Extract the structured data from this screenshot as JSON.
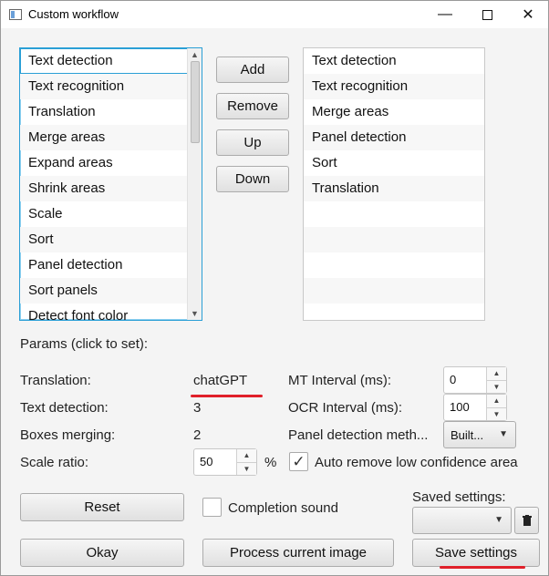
{
  "window": {
    "title": "Custom workflow"
  },
  "available_steps": [
    "Text detection",
    "Text recognition",
    "Translation",
    "Merge areas",
    "Expand areas",
    "Shrink areas",
    "Scale",
    "Sort",
    "Panel detection",
    "Sort panels",
    "Detect font color"
  ],
  "selected_steps": [
    "Text detection",
    "Text recognition",
    "Merge areas",
    "Panel detection",
    "Sort",
    "Translation"
  ],
  "buttons": {
    "add": "Add",
    "remove": "Remove",
    "up": "Up",
    "down": "Down"
  },
  "params": {
    "header": "Params (click to set):",
    "translation_label": "Translation:",
    "translation_value": "chatGPT",
    "text_detection_label": "Text detection:",
    "text_detection_value": "3",
    "boxes_merging_label": "Boxes merging:",
    "boxes_merging_value": "2",
    "scale_ratio_label": "Scale ratio:",
    "scale_ratio_value": "50",
    "scale_unit": "%",
    "mt_interval_label": "MT Interval (ms):",
    "mt_interval_value": "0",
    "ocr_interval_label": "OCR Interval (ms):",
    "ocr_interval_value": "100",
    "panel_detection_label": "Panel detection meth...",
    "panel_detection_value": "Built...",
    "auto_remove_label": "Auto remove low confidence area"
  },
  "footer": {
    "reset": "Reset",
    "completion_sound": "Completion sound",
    "saved_settings_label": "Saved settings:",
    "saved_settings_value": "",
    "okay": "Okay",
    "process_current": "Process current image",
    "save_settings": "Save settings"
  },
  "colors": {
    "focus": "#2a9fd6",
    "annotation": "#e0202a"
  }
}
